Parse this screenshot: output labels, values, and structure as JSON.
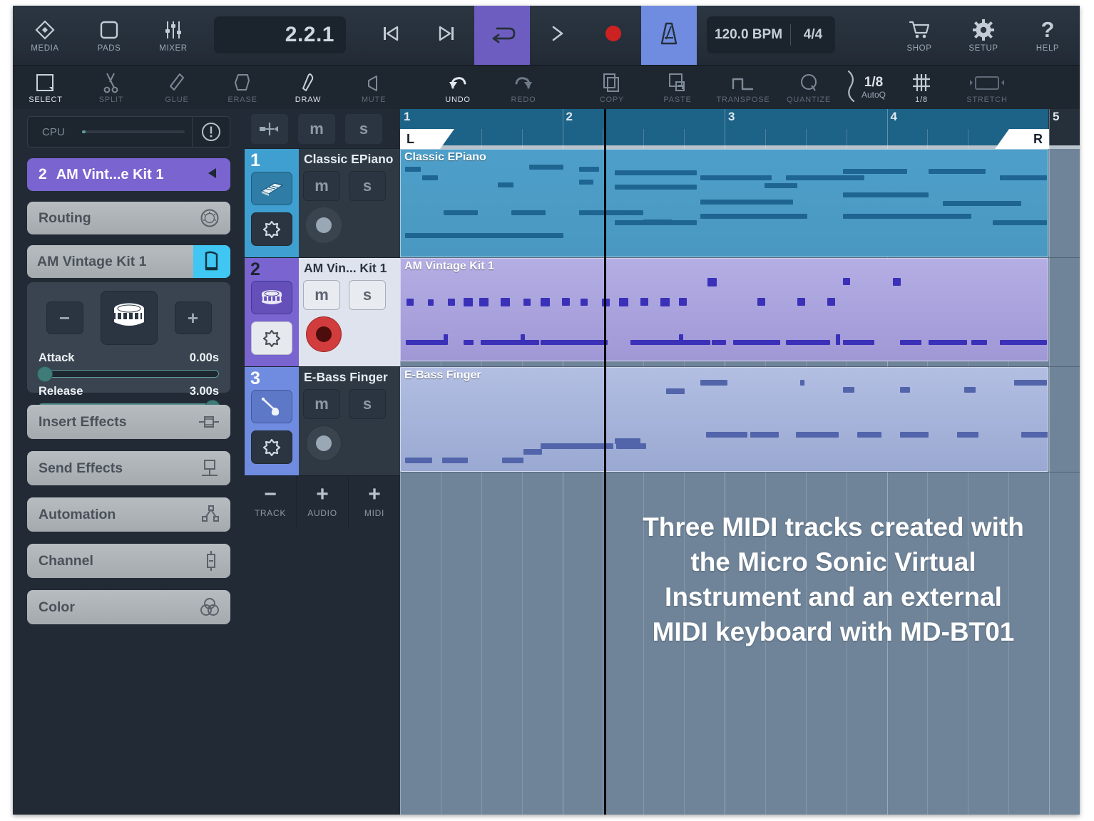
{
  "transport": {
    "left_buttons": [
      {
        "label": "MEDIA",
        "icon": "media-diamond-icon"
      },
      {
        "label": "PADS",
        "icon": "pads-square-icon"
      },
      {
        "label": "MIXER",
        "icon": "mixer-faders-icon"
      }
    ],
    "position": "2.2.1",
    "controls": [
      {
        "name": "go-to-start",
        "icon": "skip-back-icon",
        "state": "off"
      },
      {
        "name": "go-to-end",
        "icon": "skip-forward-icon",
        "state": "off"
      },
      {
        "name": "cycle-loop",
        "icon": "loop-icon",
        "state": "active-purple"
      },
      {
        "name": "play",
        "icon": "play-icon",
        "state": "off"
      },
      {
        "name": "record",
        "icon": "record-dot-icon",
        "state": "off"
      },
      {
        "name": "metronome",
        "icon": "metronome-icon",
        "state": "active-blue"
      }
    ],
    "tempo": "120.0 BPM",
    "time_signature": "4/4",
    "right_buttons": [
      {
        "label": "SHOP",
        "icon": "cart-icon"
      },
      {
        "label": "SETUP",
        "icon": "gear-icon"
      },
      {
        "label": "HELP",
        "icon": "question-mark-icon"
      }
    ]
  },
  "toolbar": {
    "tools": [
      {
        "label": "SELECT",
        "icon": "select-rect-icon",
        "active": true
      },
      {
        "label": "SPLIT",
        "icon": "scissors-icon",
        "active": false
      },
      {
        "label": "GLUE",
        "icon": "glue-tube-icon",
        "active": false
      },
      {
        "label": "ERASE",
        "icon": "eraser-icon",
        "active": false
      },
      {
        "label": "DRAW",
        "icon": "pencil-icon",
        "active": true
      },
      {
        "label": "MUTE",
        "icon": "speaker-mute-icon",
        "active": false
      },
      {
        "label": "UNDO",
        "icon": "undo-arrow-icon",
        "active": true
      },
      {
        "label": "REDO",
        "icon": "redo-arrow-icon",
        "active": false
      },
      {
        "label": "COPY",
        "icon": "copy-pages-icon",
        "active": false
      },
      {
        "label": "PASTE",
        "icon": "paste-icon",
        "active": false
      },
      {
        "label": "TRANSPOSE",
        "icon": "step-wave-icon",
        "active": false
      },
      {
        "label": "QUANTIZE",
        "icon": "q-letter-icon",
        "active": false
      }
    ],
    "autoq": {
      "value": "1/8",
      "label": "AutoQ",
      "icon": "quantize-curve-icon"
    },
    "snap": {
      "label": "1/8",
      "icon": "grid-hash-icon"
    },
    "stretch": {
      "label": "STRETCH",
      "icon": "stretch-handles-icon"
    }
  },
  "inspector": {
    "cpu": {
      "label": "CPU",
      "level_percent": 2,
      "warn_icon": "warning-circle-icon"
    },
    "selected_track": {
      "number": "2",
      "name": "AM Vint...e Kit 1",
      "collapse_icon": "triangle-left-icon"
    },
    "routing": {
      "label": "Routing",
      "icon": "knob-icon"
    },
    "instrument": {
      "name": "AM Vintage Kit 1",
      "icon": "piano-icon"
    },
    "preset": {
      "prev_icon": "minus-icon",
      "pad_icon": "snare-drum-icon",
      "next_icon": "plus-icon"
    },
    "params": [
      {
        "name": "Attack",
        "value": "0.00s",
        "fill_percent": 2
      },
      {
        "name": "Release",
        "value": "3.00s",
        "fill_percent": 97
      }
    ],
    "menu": [
      {
        "label": "Insert Effects",
        "icon": "insert-effects-icon"
      },
      {
        "label": "Send Effects",
        "icon": "send-effects-icon"
      },
      {
        "label": "Automation",
        "icon": "automation-node-icon"
      },
      {
        "label": "Channel",
        "icon": "channel-strip-icon"
      },
      {
        "label": "Color",
        "icon": "color-circles-icon"
      }
    ]
  },
  "tracklist": {
    "header": {
      "route_icon": "routing-arrows-icon",
      "mute_label": "m",
      "solo_label": "s"
    },
    "tracks": [
      {
        "number": "1",
        "name": "Classic EPiano",
        "instrument_icon": "keyboard-icon",
        "fx_icon": "fx-snowflake-icon",
        "mute_label": "m",
        "solo_label": "s",
        "selected": false,
        "record_armed": false,
        "accent": "#3e9fd0"
      },
      {
        "number": "2",
        "name": "AM Vin... Kit 1",
        "instrument_icon": "drum-icon",
        "fx_icon": "fx-snowflake-icon",
        "mute_label": "m",
        "solo_label": "s",
        "selected": true,
        "record_armed": true,
        "accent": "#7964d0"
      },
      {
        "number": "3",
        "name": "E-Bass Finger",
        "instrument_icon": "bass-guitar-icon",
        "fx_icon": "fx-snowflake-icon",
        "mute_label": "m",
        "solo_label": "s",
        "selected": false,
        "record_armed": false,
        "accent": "#6f8ce0"
      }
    ],
    "add_buttons": [
      {
        "icon": "minus-icon",
        "label": "TRACK"
      },
      {
        "icon": "plus-icon",
        "label": "AUDIO"
      },
      {
        "icon": "plus-icon",
        "label": "MIDI"
      }
    ]
  },
  "arrange": {
    "ruler": {
      "bars": [
        "1",
        "2",
        "3",
        "4",
        "5"
      ],
      "locator_left": "L",
      "locator_right": "R"
    },
    "playhead_bar": "2.2.1",
    "clips": [
      {
        "track": 1,
        "label": "Classic EPiano",
        "color": "#4a9dc9"
      },
      {
        "track": 2,
        "label": "AM Vintage Kit 1",
        "color": "#a9a4dd"
      },
      {
        "track": 3,
        "label": "E-Bass Finger",
        "color": "#a6b4da"
      }
    ]
  },
  "caption": {
    "lines": [
      "Three MIDI tracks created with",
      "the Micro Sonic Virtual",
      "Instrument and an external",
      "MIDI keyboard with MD-BT01"
    ]
  },
  "chart_data": {
    "type": "table",
    "title": "MIDI piano-roll note data (bars 1-5, 227px per bar, lanes are pitch rows)",
    "note_tracks": [
      {
        "name": "Classic EPiano",
        "color": "#1f6591",
        "clip_x": 0,
        "clip_w": 909,
        "clip_y": 0,
        "clip_h": 152,
        "notes": [
          [
            6,
            24,
            22,
            7
          ],
          [
            30,
            36,
            22,
            7
          ],
          [
            136,
            46,
            22,
            7
          ],
          [
            180,
            21,
            48,
            7
          ],
          [
            250,
            24,
            28,
            7
          ],
          [
            250,
            42,
            20,
            7
          ],
          [
            300,
            29,
            115,
            7
          ],
          [
            300,
            49,
            115,
            7
          ],
          [
            300,
            99,
            115,
            7
          ],
          [
            60,
            85,
            48,
            7
          ],
          [
            155,
            85,
            48,
            7
          ],
          [
            250,
            85,
            90,
            7
          ],
          [
            6,
            117,
            222,
            7
          ],
          [
            420,
            36,
            100,
            7
          ],
          [
            540,
            36,
            110,
            7
          ],
          [
            510,
            47,
            46,
            7
          ],
          [
            420,
            70,
            130,
            7
          ],
          [
            420,
            90,
            150,
            7
          ],
          [
            340,
            98,
            40,
            7
          ],
          [
            620,
            27,
            90,
            7
          ],
          [
            740,
            27,
            80,
            7
          ],
          [
            840,
            36,
            66,
            7
          ],
          [
            620,
            60,
            120,
            7
          ],
          [
            760,
            72,
            110,
            7
          ],
          [
            620,
            90,
            180,
            7
          ],
          [
            830,
            99,
            76,
            7
          ]
        ]
      },
      {
        "name": "AM Vintage Kit 1",
        "color": "#3b30b8",
        "clip_x": 0,
        "clip_w": 909,
        "clip_y": 0,
        "clip_h": 145,
        "notes": [
          [
            8,
            56,
            10,
            10
          ],
          [
            38,
            57,
            8,
            9
          ],
          [
            66,
            56,
            10,
            10
          ],
          [
            88,
            55,
            13,
            12
          ],
          [
            110,
            55,
            13,
            12
          ],
          [
            140,
            55,
            13,
            12
          ],
          [
            172,
            56,
            10,
            10
          ],
          [
            196,
            55,
            13,
            12
          ],
          [
            226,
            55,
            11,
            11
          ],
          [
            252,
            56,
            10,
            10
          ],
          [
            282,
            56,
            11,
            11
          ],
          [
            306,
            55,
            13,
            12
          ],
          [
            336,
            55,
            11,
            11
          ],
          [
            364,
            55,
            13,
            12
          ],
          [
            390,
            55,
            11,
            11
          ],
          [
            430,
            27,
            13,
            12
          ],
          [
            500,
            55,
            11,
            11
          ],
          [
            556,
            55,
            11,
            11
          ],
          [
            598,
            55,
            11,
            11
          ],
          [
            7,
            114,
            54,
            7
          ],
          [
            60,
            106,
            6,
            15
          ],
          [
            88,
            114,
            14,
            7
          ],
          [
            112,
            114,
            82,
            7
          ],
          [
            168,
            106,
            6,
            15
          ],
          [
            196,
            114,
            34,
            7
          ],
          [
            222,
            114,
            64,
            7
          ],
          [
            280,
            114,
            10,
            7
          ],
          [
            322,
            114,
            50,
            7
          ],
          [
            364,
            114,
            70,
            7
          ],
          [
            390,
            106,
            6,
            15
          ],
          [
            412,
            114,
            10,
            7
          ],
          [
            436,
            114,
            20,
            7
          ],
          [
            620,
            27,
            10,
            10
          ],
          [
            690,
            27,
            11,
            11
          ],
          [
            466,
            114,
            66,
            7
          ],
          [
            540,
            114,
            62,
            7
          ],
          [
            610,
            106,
            6,
            15
          ],
          [
            620,
            114,
            44,
            7
          ],
          [
            700,
            114,
            30,
            7
          ],
          [
            740,
            114,
            54,
            7
          ],
          [
            800,
            114,
            22,
            7
          ],
          [
            840,
            114,
            48,
            7
          ],
          [
            880,
            114,
            26,
            7
          ]
        ]
      },
      {
        "name": "E-Bass Finger",
        "color": "#5265ab",
        "clip_x": 0,
        "clip_w": 909,
        "clip_y": 0,
        "clip_h": 147,
        "notes": [
          [
            6,
            126,
            38,
            8
          ],
          [
            58,
            126,
            36,
            8
          ],
          [
            142,
            126,
            30,
            8
          ],
          [
            172,
            114,
            26,
            8
          ],
          [
            196,
            106,
            78,
            8
          ],
          [
            252,
            106,
            46,
            8
          ],
          [
            302,
            106,
            42,
            8
          ],
          [
            300,
            99,
            36,
            8
          ],
          [
            372,
            29,
            26,
            8
          ],
          [
            420,
            17,
            38,
            8
          ],
          [
            428,
            90,
            58,
            8
          ],
          [
            490,
            90,
            40,
            8
          ],
          [
            554,
            90,
            60,
            8
          ],
          [
            560,
            17,
            6,
            8
          ],
          [
            620,
            27,
            16,
            8
          ],
          [
            700,
            27,
            14,
            8
          ],
          [
            790,
            27,
            16,
            8
          ],
          [
            640,
            90,
            34,
            8
          ],
          [
            700,
            90,
            40,
            8
          ],
          [
            780,
            90,
            30,
            8
          ],
          [
            860,
            17,
            46,
            8
          ],
          [
            870,
            90,
            40,
            8
          ]
        ]
      }
    ]
  }
}
